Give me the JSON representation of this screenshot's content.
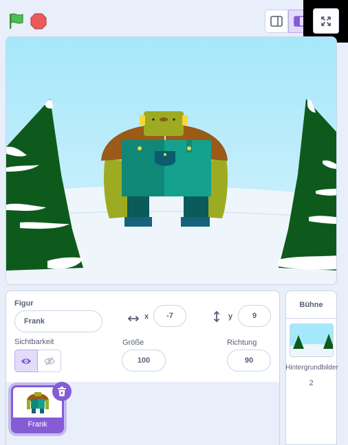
{
  "controls": {
    "green_flag": "green-flag-icon",
    "stop": "stop-icon"
  },
  "stage_modes": {
    "small": "small-stage-icon",
    "normal": "normal-stage-icon",
    "fullscreen": "fullscreen-icon"
  },
  "colors": {
    "accent": "#855cd6",
    "sky": "#a8e6f8",
    "snow": "#eef6fb",
    "tree": "#0e5a1c"
  },
  "sprite_info": {
    "sprite_label": "Figur",
    "sprite_name": "Frank",
    "x_label": "x",
    "x_value": "-7",
    "y_label": "y",
    "y_value": "9",
    "visibility_label": "Sichtbarkeit",
    "size_label": "Größe",
    "size_value": "100",
    "direction_label": "Richtung",
    "direction_value": "90"
  },
  "sprites": [
    {
      "name": "Frank",
      "selected": true
    }
  ],
  "stage_panel": {
    "title": "Bühne",
    "backdrops_label": "Hintergrundbilder",
    "backdrops_count": "2"
  }
}
